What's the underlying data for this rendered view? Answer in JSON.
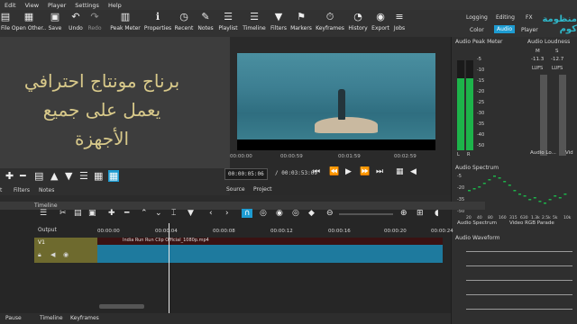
{
  "menu": [
    "Edit",
    "View",
    "Player",
    "Settings",
    "Help"
  ],
  "toolbar": [
    {
      "label": "File",
      "icon": "file-icon"
    },
    {
      "label": "Open Other..",
      "icon": "open-other-icon"
    },
    {
      "label": "Save",
      "icon": "save-icon"
    },
    {
      "label": "Undo",
      "icon": "undo-icon"
    },
    {
      "label": "Redo",
      "icon": "redo-icon"
    },
    {
      "label": "Peak Meter",
      "icon": "peak-meter-icon"
    },
    {
      "label": "Properties",
      "icon": "info-icon"
    },
    {
      "label": "Recent",
      "icon": "clock-icon"
    },
    {
      "label": "Notes",
      "icon": "notes-icon"
    },
    {
      "label": "Playlist",
      "icon": "playlist-icon"
    },
    {
      "label": "Timeline",
      "icon": "timeline-icon"
    },
    {
      "label": "Filters",
      "icon": "filter-icon"
    },
    {
      "label": "Markers",
      "icon": "marker-icon"
    },
    {
      "label": "Keyframes",
      "icon": "stopwatch-icon"
    },
    {
      "label": "History",
      "icon": "history-icon"
    },
    {
      "label": "Export",
      "icon": "export-icon"
    },
    {
      "label": "Jobs",
      "icon": "jobs-icon"
    }
  ],
  "layouts": {
    "logging": "Logging",
    "editing": "Editing",
    "fx": "FX",
    "color": "Color",
    "audio": "Audio",
    "player": "Player"
  },
  "watermark": "منظومة كوم",
  "arabic_text": [
    "برناج مونتاج احترافي",
    "يعمل على جميع",
    "الأجهزة"
  ],
  "left_tabs": {
    "a": "t",
    "filters": "Filters",
    "notes": "Notes"
  },
  "timeline_panel_title": "Timeline",
  "viewer": {
    "ruler": [
      "00:00:00",
      "00:00:59",
      "00:01:59",
      "00:02:59"
    ],
    "timecode": "00:00:05:06",
    "duration": "/ 00:03:53:09",
    "source_tab": "Source",
    "project_tab": "Project"
  },
  "peak_meter": {
    "title": "Audio Peak Meter",
    "scale": [
      "-5",
      "-10",
      "-15",
      "-20",
      "-25",
      "-30",
      "-35",
      "-40",
      "-50"
    ],
    "levels": [
      0.8,
      0.8
    ],
    "channels": [
      "L",
      "R"
    ]
  },
  "loudness": {
    "title": "Audio Loudness",
    "labels": [
      "M",
      "S"
    ],
    "values": [
      "-11.3",
      "-12.7"
    ],
    "lufs": [
      "LUFS",
      "LUFS"
    ],
    "scale": [
      "0",
      "-5",
      "-10",
      "-15",
      "-20",
      "-25",
      "-30",
      "-40",
      "-50"
    ],
    "bottom_tab": "Audio Lo...",
    "vid_tab": "Vid"
  },
  "spectrum": {
    "title": "Audio Spectrum",
    "yscale": [
      "-5",
      "-20",
      "-35",
      "-50"
    ],
    "xscale": [
      "20",
      "40",
      "80",
      "160",
      "315",
      "630",
      "1.3k",
      "2.5k",
      "5k",
      "10k"
    ],
    "tabs": [
      "Audio Spectrum",
      "Video RGB Parade"
    ]
  },
  "waveform": {
    "title": "Audio Waveform"
  },
  "timeline": {
    "output_label": "Output",
    "ruler": [
      "00:00:00",
      "00:00:04",
      "00:00:08",
      "00:00:12",
      "00:00:16",
      "00:00:20",
      "00:00:24"
    ],
    "track": "V1",
    "clip_name": "India  Run Run Clip Official_1080p.mp4"
  },
  "bottom_tabs": {
    "pause": "Pause",
    "timeline": "Timeline",
    "keyframes": "Keyframes"
  },
  "colors": {
    "accent": "#1d9bd1",
    "arabic_text": "#d8c98a",
    "meter_green": "#1db34a",
    "track_olive": "#6e6a2e",
    "clip_blue": "#1e7a9e"
  }
}
